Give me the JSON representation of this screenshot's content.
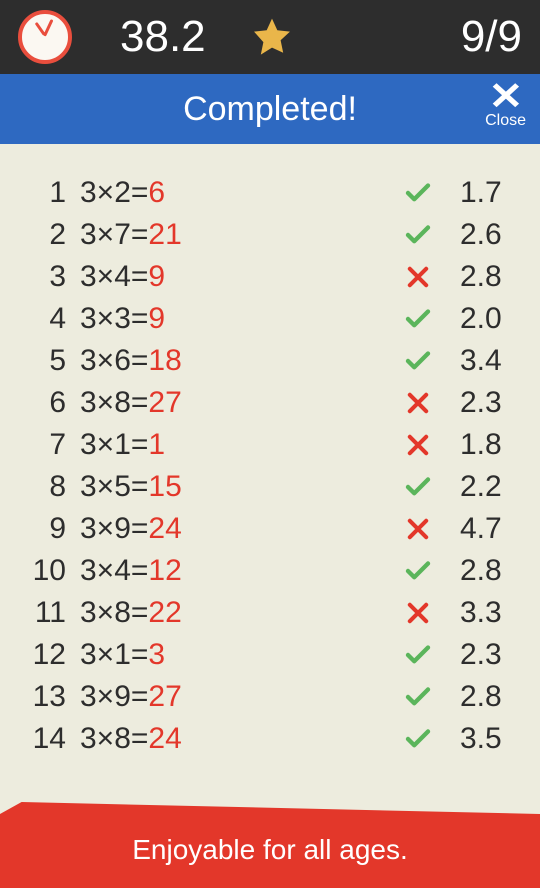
{
  "topbar": {
    "time": "38.2",
    "score": "9/9"
  },
  "header": {
    "title": "Completed!",
    "close": "Close"
  },
  "rows": [
    {
      "n": "1",
      "eq": "3×2=",
      "ans": "6",
      "ok": true,
      "t": "1.7"
    },
    {
      "n": "2",
      "eq": "3×7=",
      "ans": "21",
      "ok": true,
      "t": "2.6"
    },
    {
      "n": "3",
      "eq": "3×4=",
      "ans": "9",
      "ok": false,
      "t": "2.8"
    },
    {
      "n": "4",
      "eq": "3×3=",
      "ans": "9",
      "ok": true,
      "t": "2.0"
    },
    {
      "n": "5",
      "eq": "3×6=",
      "ans": "18",
      "ok": true,
      "t": "3.4"
    },
    {
      "n": "6",
      "eq": "3×8=",
      "ans": "27",
      "ok": false,
      "t": "2.3"
    },
    {
      "n": "7",
      "eq": "3×1=",
      "ans": "1",
      "ok": false,
      "t": "1.8"
    },
    {
      "n": "8",
      "eq": "3×5=",
      "ans": "15",
      "ok": true,
      "t": "2.2"
    },
    {
      "n": "9",
      "eq": "3×9=",
      "ans": "24",
      "ok": false,
      "t": "4.7"
    },
    {
      "n": "10",
      "eq": "3×4=",
      "ans": "12",
      "ok": true,
      "t": "2.8"
    },
    {
      "n": "11",
      "eq": "3×8=",
      "ans": "22",
      "ok": false,
      "t": "3.3"
    },
    {
      "n": "12",
      "eq": "3×1=",
      "ans": "3",
      "ok": true,
      "t": "2.3"
    },
    {
      "n": "13",
      "eq": "3×9=",
      "ans": "27",
      "ok": true,
      "t": "2.8"
    },
    {
      "n": "14",
      "eq": "3×8=",
      "ans": "24",
      "ok": true,
      "t": "3.5"
    }
  ],
  "footer": {
    "text": "Enjoyable for all ages."
  }
}
